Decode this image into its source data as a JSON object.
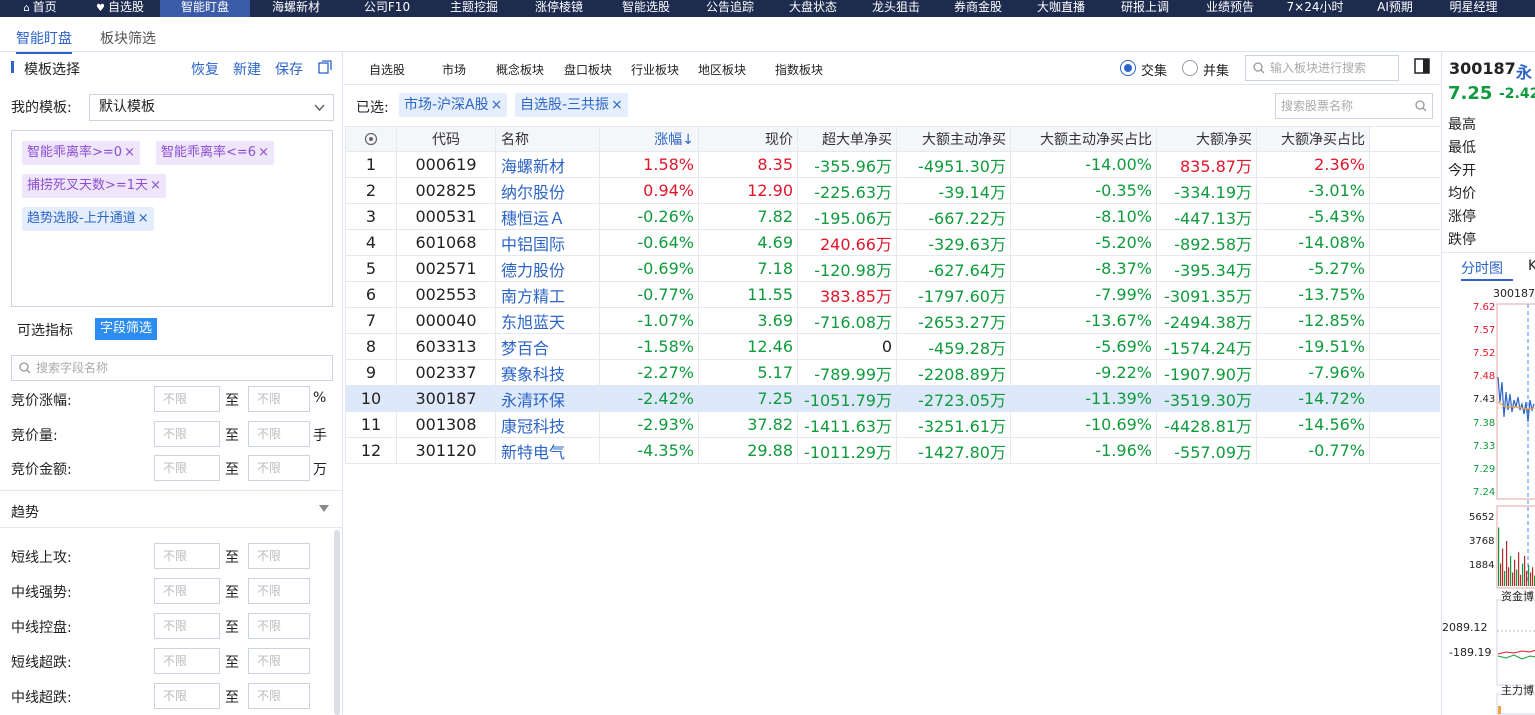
{
  "nav": [
    {
      "label": "首页",
      "icon": "home-icon"
    },
    {
      "label": "自选股",
      "icon": "heart-icon"
    },
    {
      "label": "智能盯盘"
    },
    {
      "label": "海螺新材"
    },
    {
      "label": "公司F10"
    },
    {
      "label": "主题挖掘"
    },
    {
      "label": "涨停棱镜"
    },
    {
      "label": "智能选股"
    },
    {
      "label": "公告追踪"
    },
    {
      "label": "大盘状态"
    },
    {
      "label": "龙头狙击"
    },
    {
      "label": "券商金股"
    },
    {
      "label": "大咖直播"
    },
    {
      "label": "研报上调"
    },
    {
      "label": "业绩预告"
    },
    {
      "label": "7×24小时"
    },
    {
      "label": "AI预期"
    },
    {
      "label": "明星经理"
    }
  ],
  "subtabs": [
    "智能盯盘",
    "板块筛选"
  ],
  "left": {
    "template_title": "模板选择",
    "actions": [
      "恢复",
      "新建",
      "保存"
    ],
    "my_template_label": "我的模板:",
    "template_selected": "默认模板",
    "conditions": [
      {
        "text": "智能乖离率>=0",
        "style": "purple"
      },
      {
        "text": "智能乖离率<=6",
        "style": "purple"
      },
      {
        "text": "捕捞死叉天数>=1天",
        "style": "purple"
      },
      {
        "text": "趋势选股-上升通道",
        "style": "blue"
      }
    ],
    "tab_indicators": "可选指标",
    "tab_fields": "字段筛选",
    "field_search_placeholder": "搜索字段名称",
    "auction_fields": [
      {
        "label": "竞价涨幅:",
        "unit": "%"
      },
      {
        "label": "竞价量:",
        "unit": "手"
      },
      {
        "label": "竞价金额:",
        "unit": "万"
      }
    ],
    "range_placeholder": "不限",
    "range_to": "至",
    "section_trend": "趋势",
    "trend_fields": [
      "短线上攻:",
      "中线强势:",
      "中线控盘:",
      "短线超跌:",
      "中线超跌:"
    ]
  },
  "middle": {
    "filter_tabs": [
      "自选股",
      "市场",
      "概念板块",
      "盘口板块",
      "行业板块",
      "地区板块",
      "指数板块"
    ],
    "radio_intersection": "交集",
    "radio_union": "并集",
    "sector_search_placeholder": "输入板块进行搜索",
    "selected_label": "已选:",
    "selected_tags": [
      "市场-沪深A股",
      "自选股-三共振"
    ],
    "stock_search_placeholder": "搜索股票名称",
    "columns": [
      "代码",
      "名称",
      "涨幅↓",
      "现价",
      "超大单净买",
      "大额主动净买",
      "大额主动净买占比",
      "大额净买",
      "大额净买占比"
    ],
    "rows": [
      {
        "no": "1",
        "code": "000619",
        "name": "海螺新材",
        "chg": "1.58%",
        "price": "8.35",
        "xl": "-355.96万",
        "ba": "-4951.30万",
        "bar": "-14.00%",
        "bn": "835.87万",
        "bnr": "2.36%"
      },
      {
        "no": "2",
        "code": "002825",
        "name": "纳尔股份",
        "chg": "0.94%",
        "price": "12.90",
        "xl": "-225.63万",
        "ba": "-39.14万",
        "bar": "-0.35%",
        "bn": "-334.19万",
        "bnr": "-3.01%"
      },
      {
        "no": "3",
        "code": "000531",
        "name": "穗恒运Ａ",
        "chg": "-0.26%",
        "price": "7.82",
        "xl": "-195.06万",
        "ba": "-667.22万",
        "bar": "-8.10%",
        "bn": "-447.13万",
        "bnr": "-5.43%"
      },
      {
        "no": "4",
        "code": "601068",
        "name": "中铝国际",
        "chg": "-0.64%",
        "price": "4.69",
        "xl": "240.66万",
        "ba": "-329.63万",
        "bar": "-5.20%",
        "bn": "-892.58万",
        "bnr": "-14.08%"
      },
      {
        "no": "5",
        "code": "002571",
        "name": "德力股份",
        "chg": "-0.69%",
        "price": "7.18",
        "xl": "-120.98万",
        "ba": "-627.64万",
        "bar": "-8.37%",
        "bn": "-395.34万",
        "bnr": "-5.27%"
      },
      {
        "no": "6",
        "code": "002553",
        "name": "南方精工",
        "chg": "-0.77%",
        "price": "11.55",
        "xl": "383.85万",
        "ba": "-1797.60万",
        "bar": "-7.99%",
        "bn": "-3091.35万",
        "bnr": "-13.75%"
      },
      {
        "no": "7",
        "code": "000040",
        "name": "东旭蓝天",
        "chg": "-1.07%",
        "price": "3.69",
        "xl": "-716.08万",
        "ba": "-2653.27万",
        "bar": "-13.67%",
        "bn": "-2494.38万",
        "bnr": "-12.85%"
      },
      {
        "no": "8",
        "code": "603313",
        "name": "梦百合",
        "chg": "-1.58%",
        "price": "12.46",
        "xl": "0",
        "ba": "-459.28万",
        "bar": "-5.69%",
        "bn": "-1574.24万",
        "bnr": "-19.51%"
      },
      {
        "no": "9",
        "code": "002337",
        "name": "赛象科技",
        "chg": "-2.27%",
        "price": "5.17",
        "xl": "-789.99万",
        "ba": "-2208.89万",
        "bar": "-9.22%",
        "bn": "-1907.90万",
        "bnr": "-7.96%"
      },
      {
        "no": "10",
        "code": "300187",
        "name": "永清环保",
        "chg": "-2.42%",
        "price": "7.25",
        "xl": "-1051.79万",
        "ba": "-2723.05万",
        "bar": "-11.39%",
        "bn": "-3519.30万",
        "bnr": "-14.72%"
      },
      {
        "no": "11",
        "code": "001308",
        "name": "康冠科技",
        "chg": "-2.93%",
        "price": "37.82",
        "xl": "-1411.63万",
        "ba": "-3251.61万",
        "bar": "-10.69%",
        "bn": "-4428.81万",
        "bnr": "-14.56%"
      },
      {
        "no": "12",
        "code": "301120",
        "name": "新特电气",
        "chg": "-4.35%",
        "price": "29.88",
        "xl": "-1011.29万",
        "ba": "-1427.80万",
        "bar": "-1.96%",
        "bn": "-557.09万",
        "bnr": "-0.77%"
      }
    ]
  },
  "right": {
    "code": "300187",
    "name_partial": "永",
    "price": "7.25",
    "change_partial": "-2.42",
    "quote_labels": [
      "最高",
      "最低",
      "今开",
      "均价",
      "涨停",
      "跌停"
    ],
    "chart_tabs": [
      "分时图",
      "K"
    ],
    "chart_code": "300187",
    "price_ticks": [
      "7.62",
      "7.57",
      "7.52",
      "7.48",
      "7.43",
      "7.38",
      "7.33",
      "7.29",
      "7.24"
    ],
    "volume_ticks": [
      "5652",
      "3768",
      "1884"
    ],
    "fund_label_1": "资金博",
    "fund_ticks": [
      "2089.12",
      "-189.19"
    ],
    "fund_label_2": "主力博"
  },
  "colors": {
    "nav_bg": "#1d2b4e",
    "accent": "#2d65c8",
    "up": "#e0162b",
    "down": "#0f9b3c"
  }
}
